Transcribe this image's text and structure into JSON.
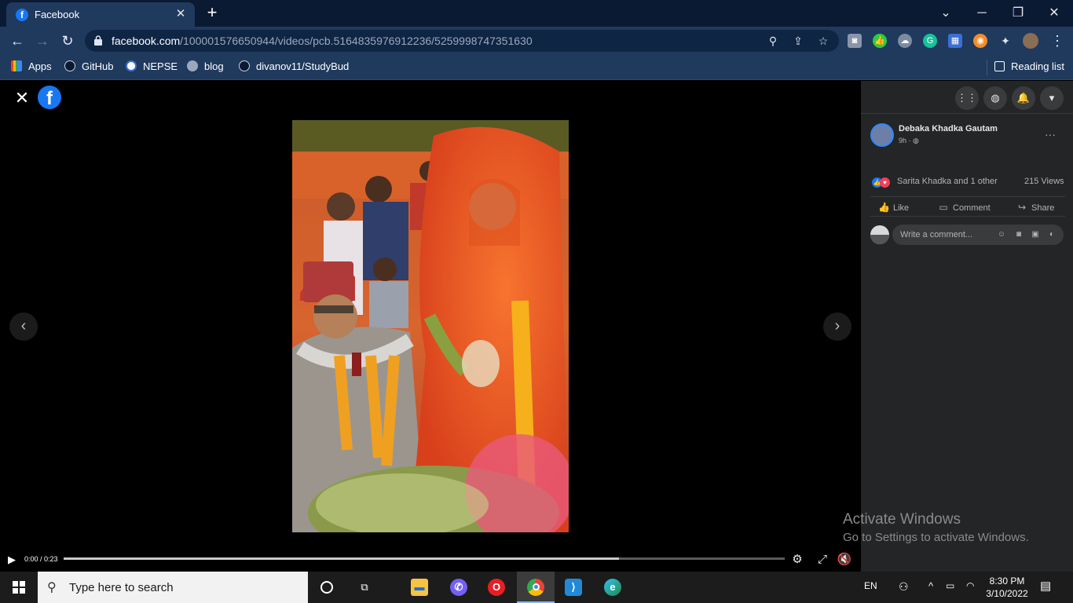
{
  "browser": {
    "tab": {
      "title": "Facebook",
      "favicon": "f"
    },
    "window": {
      "minimize": "─",
      "restore": "❐",
      "close": "✕",
      "dropdown": "⌄"
    },
    "url": {
      "host": "facebook.com",
      "path": "/100001576650944/videos/pcb.5164835976912236/5259998747351630"
    },
    "extension_badge": "0",
    "bookmarks": [
      {
        "label": "Apps",
        "icon": "apps-grid-icon"
      },
      {
        "label": "GitHub",
        "icon": "github-icon"
      },
      {
        "label": "NEPSE",
        "icon": "nepse-icon"
      },
      {
        "label": "blog",
        "icon": "globe-icon"
      },
      {
        "label": "divanov11/StudyBud",
        "icon": "github-icon"
      }
    ],
    "reading_list": "Reading list"
  },
  "viewer": {
    "time": "0:00 / 0:23",
    "progress": 0.77
  },
  "post": {
    "author": "Debaka Khadka Gautam",
    "age": "9h ·",
    "reactions_text": "Sarita Khadka and 1 other",
    "views": "215 Views",
    "actions": {
      "like": "Like",
      "comment": "Comment",
      "share": "Share"
    },
    "comment_placeholder": "Write a comment..."
  },
  "watermark": {
    "title": "Activate Windows",
    "subtitle": "Go to Settings to activate Windows."
  },
  "taskbar": {
    "search_placeholder": "Type here to search",
    "lang": "EN",
    "time": "8:30 PM",
    "date": "3/10/2022"
  },
  "colors": {
    "facebook_blue": "#1877f2",
    "panel_bg": "#242526",
    "chrome_toolbar": "#203a5e"
  }
}
